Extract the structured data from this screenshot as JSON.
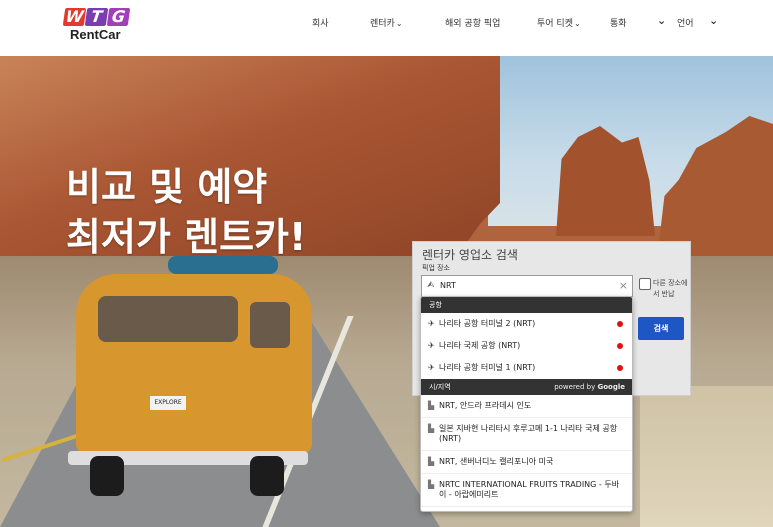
{
  "logo": {
    "letters": [
      "W",
      "T",
      "G"
    ],
    "text": "RentCar",
    "colors": [
      "#e23a2c",
      "#7a3db0",
      "#a23fb8"
    ]
  },
  "nav": {
    "items": [
      {
        "label": "회사",
        "chevron": ""
      },
      {
        "label": "렌터카",
        "chevron": "⌄"
      },
      {
        "label": "해외 공항 픽업",
        "chevron": ""
      },
      {
        "label": "투어 티켓",
        "chevron": "⌄"
      },
      {
        "label": "통화",
        "chevron": ""
      },
      {
        "label": "언어",
        "chevron": ""
      }
    ]
  },
  "hero": {
    "line1": "비교 및 예약",
    "line2": "최저가 렌트카!",
    "plate": "EXPLORE"
  },
  "search": {
    "title": "렌터카 영업소 검색",
    "pickup_label": "픽업 장소",
    "value": "NRT",
    "clear": "×",
    "return_label": "다른 장소에서 반납",
    "button": "검색"
  },
  "dropdown": {
    "airport_header": "공항",
    "airports": [
      "나리타 공항 터미널 2 (NRT)",
      "나리타 국제 공항 (NRT)",
      "나리타 공항 터미널 1 (NRT)"
    ],
    "city_header": "시/지역",
    "powered_prefix": "powered by",
    "powered_brand": "Google",
    "cities": [
      "NRT, 안드라 프라데시 인도",
      "일본 지바현 나리타시 후루고메 1-1 나리타 국제 공항 (NRT)",
      "NRT, 샌버너디노 캘리포니아 미국",
      "NRTC INTERNATIONAL FRUITS TRADING - 두바이 - 아랍에미리트"
    ]
  },
  "colors": {
    "accent": "#1e56c4",
    "marker": "#e01010"
  }
}
